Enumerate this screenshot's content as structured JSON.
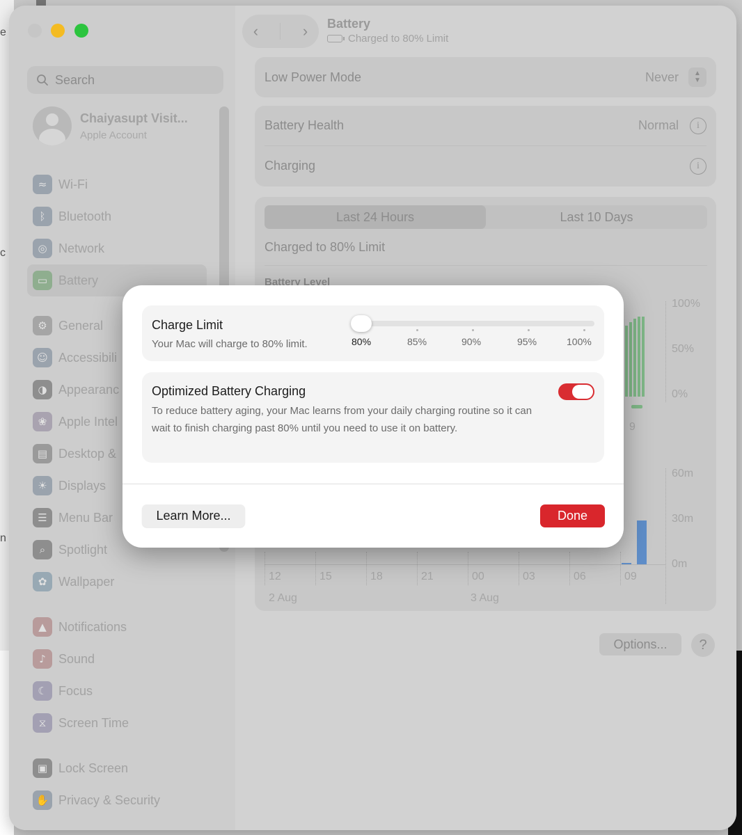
{
  "desktop": {
    "letters": [
      "e",
      "c",
      "n"
    ]
  },
  "window": {
    "title": "Battery",
    "subtitle": "Charged to 80% Limit"
  },
  "sidebar": {
    "search_placeholder": "Search",
    "account": {
      "name": "Chaiyasupt Visit...",
      "sub": "Apple Account"
    },
    "items": [
      {
        "label": "Wi-Fi",
        "icon": "wifi-icon",
        "color": "#9aa3ad"
      },
      {
        "label": "Bluetooth",
        "icon": "bluetooth-icon",
        "color": "#9aa3ad"
      },
      {
        "label": "Network",
        "icon": "globe-icon",
        "color": "#9aa3ad"
      },
      {
        "label": "Battery",
        "icon": "battery-icon",
        "color": "#8fae8f"
      },
      {
        "label": "General",
        "icon": "gear-icon",
        "color": "#a5a5a5"
      },
      {
        "label": "Accessibili",
        "icon": "accessibility-icon",
        "color": "#9aa3ad"
      },
      {
        "label": "Appearanc",
        "icon": "appearance-icon",
        "color": "#8e8e8e"
      },
      {
        "label": "Apple Intel",
        "icon": "apple-intelligence-icon",
        "color": "#a9a3b0"
      },
      {
        "label": "Desktop &",
        "icon": "desktop-icon",
        "color": "#9a9a9a"
      },
      {
        "label": "Displays",
        "icon": "displays-icon",
        "color": "#9aa3ad"
      },
      {
        "label": "Menu Bar",
        "icon": "menubar-icon",
        "color": "#8e8e8e"
      },
      {
        "label": "Spotlight",
        "icon": "spotlight-icon",
        "color": "#8e8e8e"
      },
      {
        "label": "Wallpaper",
        "icon": "wallpaper-icon",
        "color": "#98a9b4"
      },
      {
        "label": "Notifications",
        "icon": "notifications-icon",
        "color": "#b89b9b"
      },
      {
        "label": "Sound",
        "icon": "sound-icon",
        "color": "#b89b9b"
      },
      {
        "label": "Focus",
        "icon": "focus-icon",
        "color": "#a3a0b3"
      },
      {
        "label": "Screen Time",
        "icon": "hourglass-icon",
        "color": "#a3a0b3"
      },
      {
        "label": "Lock Screen",
        "icon": "lock-icon",
        "color": "#8e8e8e"
      },
      {
        "label": "Privacy & Security",
        "icon": "hand-icon",
        "color": "#9aa3ad"
      }
    ]
  },
  "main": {
    "low_power": {
      "label": "Low Power Mode",
      "value": "Never"
    },
    "health": {
      "label": "Battery Health",
      "value": "Normal"
    },
    "charging": {
      "label": "Charging"
    },
    "tabs": [
      "Last 24 Hours",
      "Last 10 Days"
    ],
    "charged_text": "Charged to 80% Limit",
    "battery_level_title": "Battery Level",
    "level_axis": [
      "100%",
      "50%",
      "0%"
    ],
    "level_partial_tick": "9",
    "usage_axis": [
      "60m",
      "30m",
      "0m"
    ],
    "x_ticks": [
      "12",
      "15",
      "18",
      "21",
      "00",
      "03",
      "06",
      "09"
    ],
    "x_dates": [
      "2 Aug",
      "3 Aug"
    ],
    "options_label": "Options...",
    "help_label": "?"
  },
  "modal": {
    "charge_limit": {
      "title": "Charge Limit",
      "sub": "Your Mac will charge to 80% limit.",
      "ticks": [
        "80%",
        "85%",
        "90%",
        "95%",
        "100%"
      ]
    },
    "optimized": {
      "title": "Optimized Battery Charging",
      "desc": "To reduce battery aging, your Mac learns from your daily charging routine so it can wait to finish charging past 80% until you need to use it on battery."
    },
    "learn_more": "Learn More...",
    "done": "Done",
    "accent": "#d9262c"
  }
}
